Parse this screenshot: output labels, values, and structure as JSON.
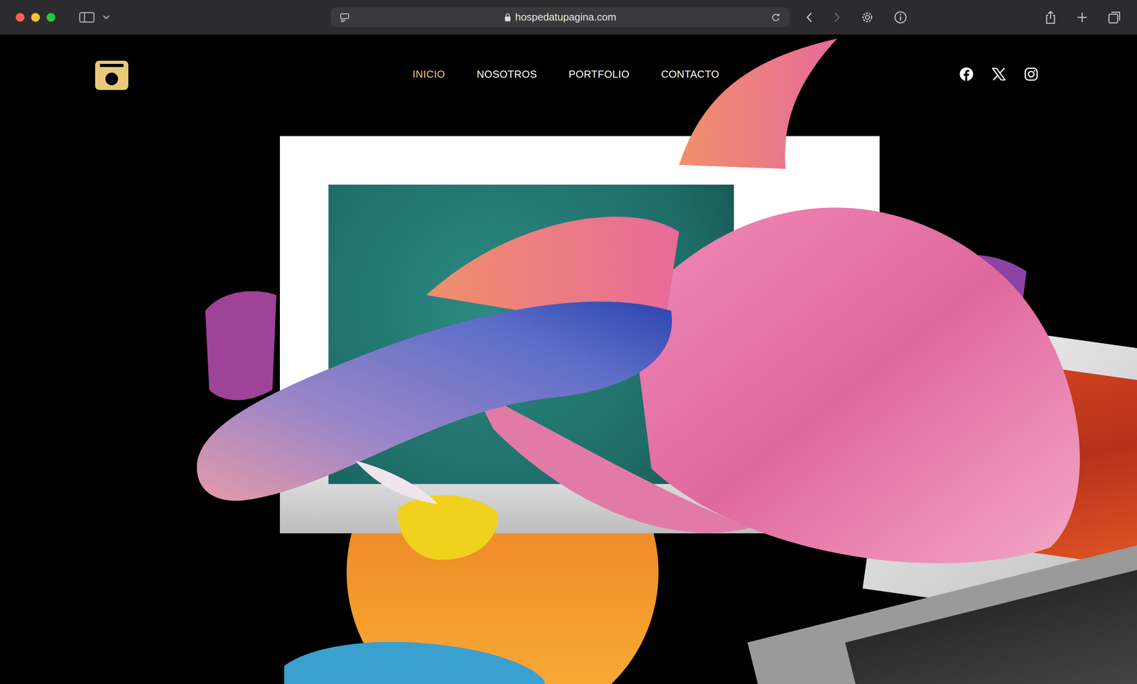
{
  "browser": {
    "url": "hospedatupagina.com"
  },
  "nav": [
    {
      "label": "INICIO",
      "selected": true
    },
    {
      "label": "NOSOTROS",
      "selected": false
    },
    {
      "label": "PORTFOLIO",
      "selected": false
    },
    {
      "label": "CONTACTO",
      "selected": false
    }
  ]
}
